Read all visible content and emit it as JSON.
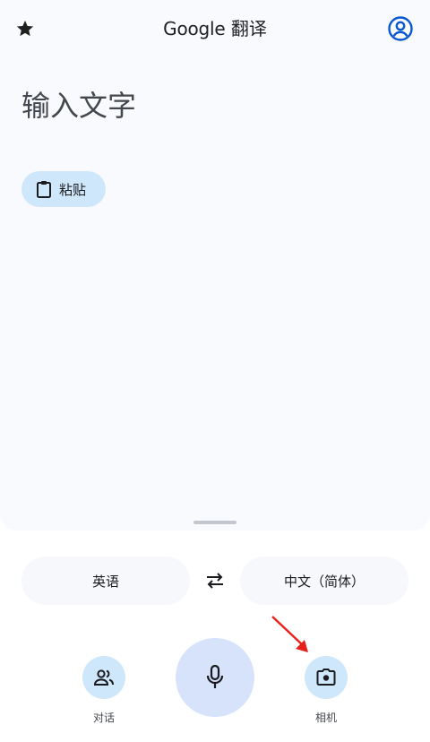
{
  "app": {
    "title_brand": "Google",
    "title_suffix": "翻译"
  },
  "input": {
    "placeholder": "输入文字"
  },
  "paste": {
    "label": "粘贴"
  },
  "languages": {
    "source": "英语",
    "target": "中文（简体）"
  },
  "actions": {
    "conversation_label": "对话",
    "camera_label": "相机"
  },
  "icons": {
    "star": "star-icon",
    "account": "account-icon",
    "clipboard": "clipboard-icon",
    "swap": "swap-icon",
    "people": "people-icon",
    "mic": "mic-icon",
    "camera": "camera-icon",
    "annotation": "red-arrow-annotation"
  },
  "colors": {
    "accent_blue": "#0b57d0",
    "chip_blue": "#cfe7fb",
    "mic_blue": "#d6e3fb",
    "annotation_red": "#e8201c"
  }
}
